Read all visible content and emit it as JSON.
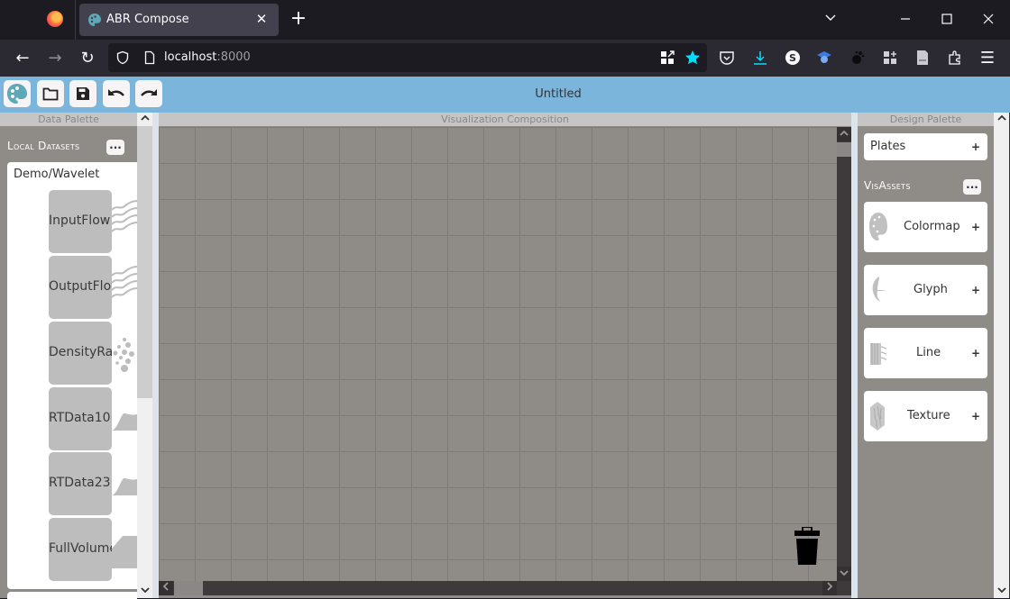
{
  "browser": {
    "tab_title": "ABR Compose",
    "tab_close": "✕",
    "new_tab": "+",
    "window_controls": {
      "list": "⌵",
      "minimize": "—",
      "maximize": "☐",
      "close": "✕"
    },
    "nav": {
      "back": "←",
      "forward": "→",
      "reload": "↻"
    },
    "url_host": "localhost",
    "url_port": ":8000",
    "menu": "☰"
  },
  "app": {
    "document_title": "Untitled",
    "toolbar": [
      {
        "name": "app-logo",
        "icon": "palette-icon"
      },
      {
        "name": "open",
        "icon": "folder-icon"
      },
      {
        "name": "save",
        "icon": "floppy-icon"
      },
      {
        "name": "undo",
        "icon": "undo-icon"
      },
      {
        "name": "redo",
        "icon": "redo-icon"
      }
    ],
    "panels": {
      "data_palette": "Data Palette",
      "visualization_composition": "Visualization Composition",
      "design_palette": "Design Palette"
    },
    "data_palette": {
      "section_title": "Local Datasets",
      "more_label": "...",
      "dataset": "Demo/Wavelet",
      "items": [
        {
          "label": "InputFlow",
          "glyph": "streamlines"
        },
        {
          "label": "OutputFlow",
          "glyph": "streamlines"
        },
        {
          "label": "DensityRa",
          "glyph": "points"
        },
        {
          "label": "RTData10",
          "glyph": "scalar-curve"
        },
        {
          "label": "RTData23",
          "glyph": "scalar-curve"
        },
        {
          "label": "FullVolume",
          "glyph": "volume"
        }
      ]
    },
    "design_palette": {
      "plates_label": "Plates",
      "plus": "+",
      "visassets_title": "VisAssets",
      "more_label": "...",
      "visassets": [
        {
          "label": "Colormap",
          "icon": "palette-icon"
        },
        {
          "label": "Glyph",
          "icon": "leaf-glyph-icon"
        },
        {
          "label": "Line",
          "icon": "line-texture-icon"
        },
        {
          "label": "Texture",
          "icon": "wood-texture-icon"
        }
      ]
    },
    "scroll": {
      "up": "⌃",
      "down": "⌄",
      "left": "‹",
      "right": "›"
    }
  }
}
